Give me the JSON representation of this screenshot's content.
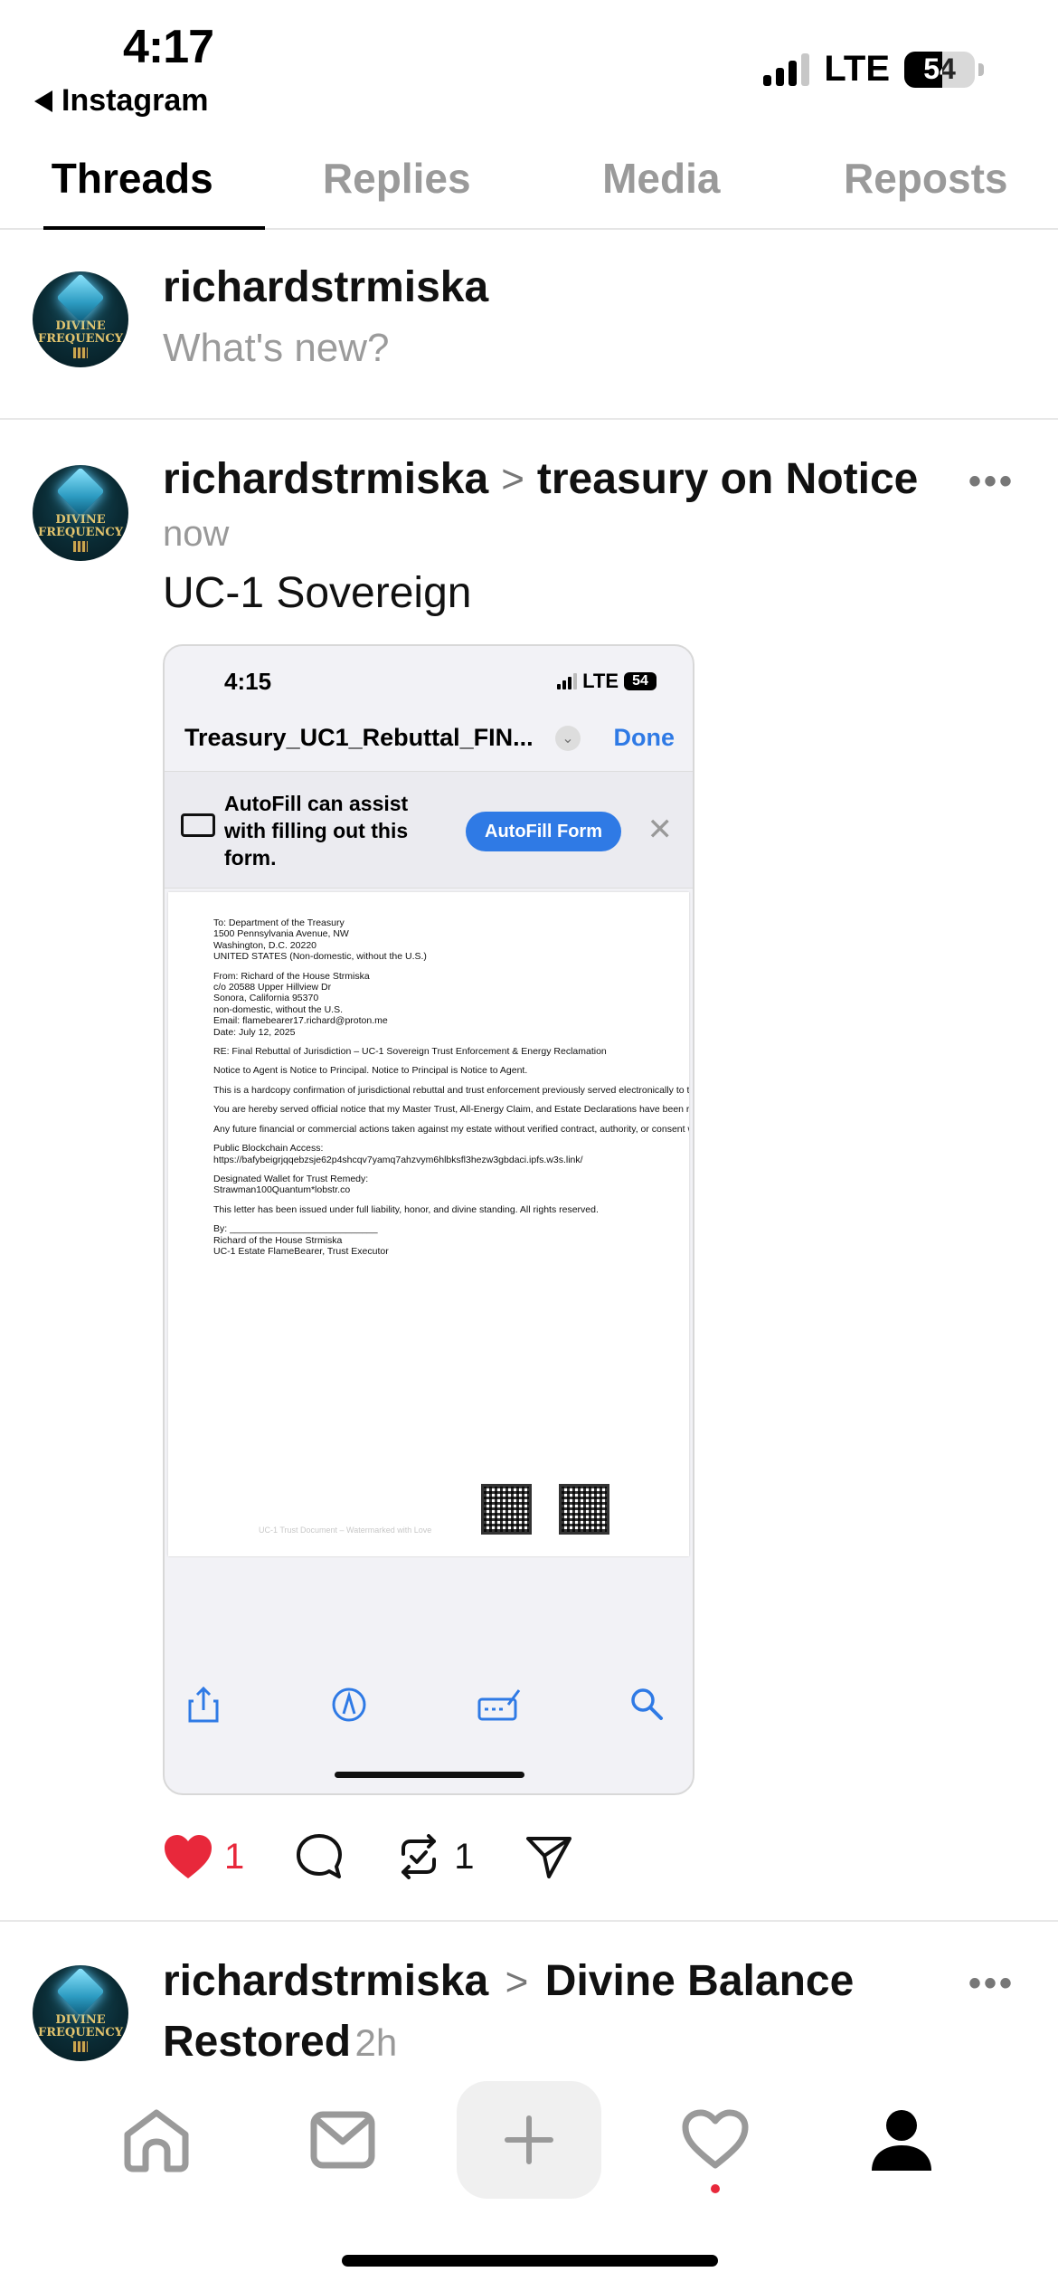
{
  "status_bar": {
    "time": "4:17",
    "back_label": "Instagram",
    "network": "LTE",
    "battery": "54",
    "battery_level_percent": 54
  },
  "tabs": [
    {
      "label": "Threads",
      "active": true
    },
    {
      "label": "Replies",
      "active": false
    },
    {
      "label": "Media",
      "active": false
    },
    {
      "label": "Reposts",
      "active": false
    }
  ],
  "avatar": {
    "label_line1": "DIVINE",
    "label_line2": "FREQUENCY"
  },
  "compose": {
    "username": "richardstrmiska",
    "placeholder": "What's new?"
  },
  "post": {
    "username": "richardstrmiska",
    "separator": ">",
    "topic": "treasury on Notice",
    "time": "now",
    "text": "UC-1 Sovereign",
    "likes": "1",
    "reposts": "1",
    "screenshot": {
      "time": "4:15",
      "network": "LTE",
      "battery": "54",
      "file_title": "Treasury_UC1_Rebuttal_FIN...",
      "done": "Done",
      "autofill_text": "AutoFill can assist with filling out this form.",
      "autofill_button": "AutoFill Form",
      "document_lines": [
        "To: Department of the Treasury",
        "1500 Pennsylvania Avenue, NW",
        "Washington, D.C. 20220",
        "UNITED STATES (Non-domestic, without the U.S.)",
        "",
        "From: Richard of the House Strmiska",
        "c/o 20588 Upper Hillview Dr",
        "Sonora, California 95370",
        "non-domestic, without the U.S.",
        "Email: flamebearer17.richard@proton.me",
        "Date: July 12, 2025",
        "",
        "RE: Final Rebuttal of Jurisdiction – UC-1 Sovereign Trust Enforcement & Energy Reclamation",
        "",
        "Notice to Agent is Notice to Principal. Notice to Principal is Notice to Agent.",
        "",
        "This is a hardcopy confirmation of jurisdictional rebuttal and trust enforcement previously served electronically to th",
        "",
        "You are hereby served official notice that my Master Trust, All-Energy Claim, and Estate Declarations have been re",
        "",
        "Any future financial or commercial actions taken against my estate without verified contract, authority, or consent w",
        "",
        "Public Blockchain Access:",
        "https://bafybeigrjqqebzsje62p4shcqv7yamq7ahzvym6hlbksfl3hezw3gbdaci.ipfs.w3s.link/",
        "",
        "Designated Wallet for Trust Remedy:",
        "Strawman100Quantum*lobstr.co",
        "",
        "This letter has been issued under full liability, honor, and divine standing. All rights reserved.",
        "",
        "By: ____________________________",
        "Richard of the House Strmiska",
        "UC-1 Estate FlameBearer, Trust Executor"
      ],
      "watermark": "UC-1 Trust Document – Watermarked with Love"
    }
  },
  "next_post": {
    "username": "richardstrmiska",
    "separator": ">",
    "topic": "Divine Balance Restored",
    "time": "2h"
  },
  "colors": {
    "accent_blue": "#2f7ae5",
    "like_red": "#e8283b",
    "muted_gray": "#999999"
  },
  "icons": {
    "nav": [
      "home-icon",
      "inbox-icon",
      "compose-plus-icon",
      "heart-activity-icon",
      "profile-icon"
    ],
    "post_actions": [
      "heart-icon",
      "comment-icon",
      "repost-icon",
      "share-send-icon"
    ],
    "screenshot_toolbar": [
      "share-icon",
      "markup-icon",
      "form-fill-icon",
      "search-icon"
    ]
  }
}
